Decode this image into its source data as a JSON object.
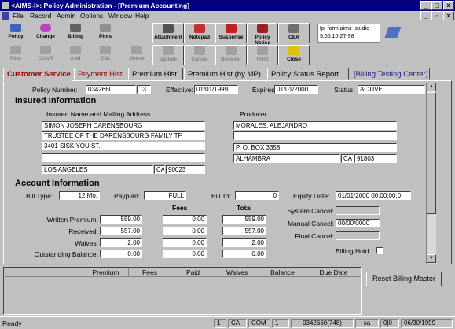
{
  "window": {
    "title": "<AIMS-I>: Policy Administration - [Premium Accounting]",
    "min": "_",
    "max": "□",
    "close": "×"
  },
  "menu": [
    "File",
    "Record",
    "Admin",
    "Options",
    "Window",
    "Help"
  ],
  "toolbar_row1": [
    "Policy",
    "Change",
    "Billing",
    "Pints",
    "Attachment",
    "Notepad",
    "Suspense",
    "Policy Notice",
    "CEA"
  ],
  "toolbar_row2": [
    "Find",
    "ClosR",
    "Add",
    "Edit",
    "Delete",
    "Update",
    "Cancel",
    "Browser",
    "Print",
    "Close"
  ],
  "info_box": {
    "line1": "fp_form.aims_studio",
    "line2": "5.55.10-27-98"
  },
  "tabs": [
    "Customer Service",
    "Payment Hist",
    "Premium Hist",
    "Premium Hist (by MP)",
    "Policy Status Report",
    "[Billing Testing Center]"
  ],
  "policy": {
    "number_label": "Policy Number:",
    "number": "0342660",
    "suffix": "13",
    "effective_label": "Effective:",
    "effective": "01/01/1999",
    "expires_label": "Expires",
    "expires": "01/01/2000",
    "status_label": "Status:",
    "status": "ACTIVE"
  },
  "insured": {
    "section": "Insured Information",
    "name_label": "Insured Name and Mailing Address",
    "lines": [
      "SIMON JOSEPH DARENSBOURG",
      "TRUSTEE OF THE DARENSBOURG FAMILY TF",
      "3401 SISKIYOU ST.",
      ""
    ],
    "city": "LOS ANGELES",
    "state": "CA",
    "zip": "90023",
    "producer_label": "Producer",
    "producer_lines": [
      "MORALES, ALEJANDRO",
      "",
      "P. O. BOX 3358"
    ],
    "producer_city": "ALHAMBRA",
    "producer_state": "CA",
    "producer_zip": "91803"
  },
  "account": {
    "section": "Account Information",
    "bill_type_label": "Bill Type:",
    "bill_type": "12 Mo.",
    "payplan_label": "Payplan:",
    "payplan": "FULL",
    "bill_to_label": "Bill To:",
    "bill_to": "0",
    "equity_label": "Equity Date:",
    "equity": "01/01/2000 00:00:00:0",
    "system_cancel_label": "System Cancel:",
    "system_cancel": "",
    "manual_cancel_label": "Manual Cancel:",
    "manual_cancel": "00/00/0000",
    "final_cancel_label": "Final Cancel:",
    "final_cancel": "",
    "billing_hold_label": "Billing Hold",
    "fees_header": "Fees",
    "total_header": "Total",
    "rows": [
      {
        "label": "Written Premium:",
        "amount": "559.00",
        "fees": "0.00",
        "total": "559.00"
      },
      {
        "label": "Received:",
        "amount": "557.00",
        "fees": "0.00",
        "total": "557.00"
      },
      {
        "label": "Waives:",
        "amount": "2.00",
        "fees": "0.00",
        "total": "2.00"
      },
      {
        "label": "Outstanding Balance:",
        "amount": "0.00",
        "fees": "0.00",
        "total": "0.00"
      }
    ]
  },
  "grid_headers": [
    "",
    "Premium",
    "Fees",
    "Paid",
    "Waives",
    "Balance",
    "Due Date"
  ],
  "reset_button": "Reset Billing Master",
  "status": {
    "ready": "Ready",
    "c1": "1",
    "c2": "CA",
    "c3": "COM",
    "c4": "1",
    "c5": "0342660(748)",
    "c6": "sa",
    "c7": "0|0",
    "date": "06/30/1999"
  },
  "colors": {
    "title_bg": "#000080",
    "chrome": "#c0c0c0",
    "active_tab": "#a00000",
    "link_tab": "#1a1a80"
  }
}
